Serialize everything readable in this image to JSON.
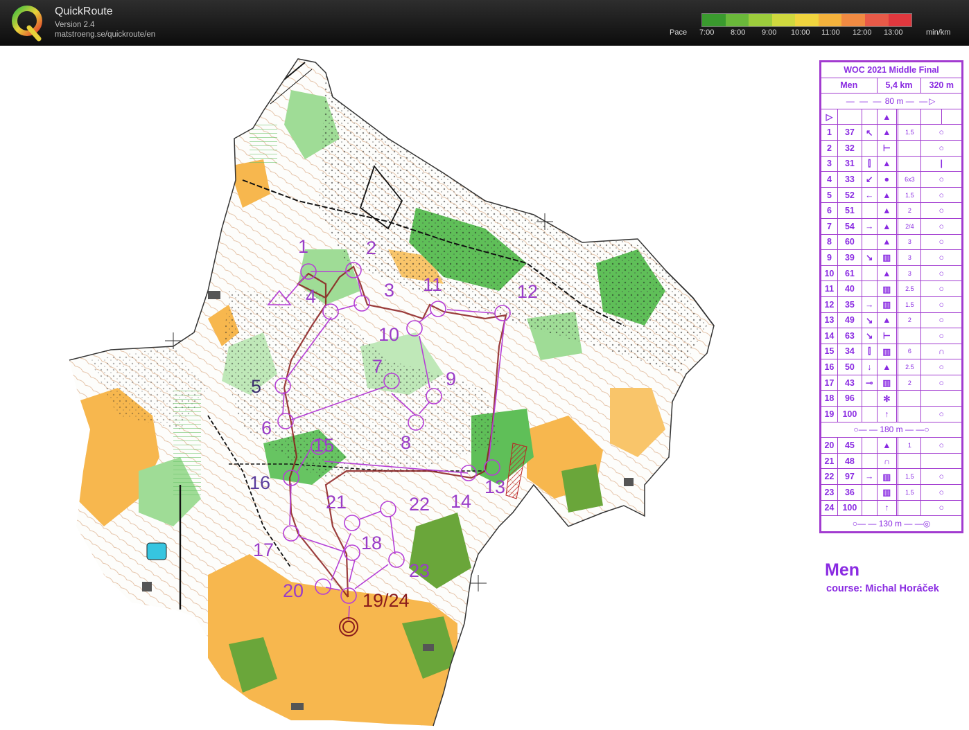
{
  "app": {
    "title": "QuickRoute",
    "version": "Version 2.4",
    "url": "matstroeng.se/quickroute/en",
    "logo_letter": "Q"
  },
  "pace_legend": {
    "label": "Pace",
    "ticks": [
      "7:00",
      "8:00",
      "9:00",
      "10:00",
      "11:00",
      "12:00",
      "13:00"
    ],
    "unit": "min/km",
    "gradient_colors": [
      "#3a9a2e",
      "#6ab83a",
      "#9ccc3c",
      "#cfd83e",
      "#f0d43e",
      "#f4b23c",
      "#f08a42",
      "#e85a48",
      "#e0383e"
    ]
  },
  "map": {
    "control_numbers": [
      "1",
      "2",
      "3",
      "4",
      "5",
      "6",
      "7",
      "8",
      "9",
      "10",
      "11",
      "12",
      "13",
      "14",
      "15",
      "16",
      "17",
      "18",
      "19/24",
      "20",
      "21",
      "22",
      "23"
    ],
    "colors": {
      "course": "#b53ed6",
      "route": "#8a1c1c",
      "open": "#f7b74e",
      "green": "#4fb84a",
      "contour": "#b05a1e"
    }
  },
  "control_descriptions": {
    "event": "WOC 2021 Middle Final",
    "class": "Men",
    "length": "5,4 km",
    "climb": "320 m",
    "start_marker": "80 m",
    "taped_route": "180 m",
    "finish_marker": "130 m",
    "rows": [
      {
        "n": "1",
        "code": "37",
        "dim": "1.5"
      },
      {
        "n": "2",
        "code": "32",
        "dim": ""
      },
      {
        "n": "3",
        "code": "31",
        "dim": ""
      },
      {
        "n": "4",
        "code": "33",
        "dim": "6x3"
      },
      {
        "n": "5",
        "code": "52",
        "dim": "1.5"
      },
      {
        "n": "6",
        "code": "51",
        "dim": "2"
      },
      {
        "n": "7",
        "code": "54",
        "dim": "2/4"
      },
      {
        "n": "8",
        "code": "60",
        "dim": "3"
      },
      {
        "n": "9",
        "code": "39",
        "dim": "3"
      },
      {
        "n": "10",
        "code": "61",
        "dim": "3"
      },
      {
        "n": "11",
        "code": "40",
        "dim": "2.5"
      },
      {
        "n": "12",
        "code": "35",
        "dim": "1.5"
      },
      {
        "n": "13",
        "code": "49",
        "dim": "2"
      },
      {
        "n": "14",
        "code": "63",
        "dim": ""
      },
      {
        "n": "15",
        "code": "34",
        "dim": "6"
      },
      {
        "n": "16",
        "code": "50",
        "dim": "2.5"
      },
      {
        "n": "17",
        "code": "43",
        "dim": "2"
      },
      {
        "n": "18",
        "code": "96",
        "dim": ""
      },
      {
        "n": "19",
        "code": "100",
        "dim": ""
      },
      {
        "n": "20",
        "code": "45",
        "dim": "1"
      },
      {
        "n": "21",
        "code": "48",
        "dim": ""
      },
      {
        "n": "22",
        "code": "97",
        "dim": "1.5"
      },
      {
        "n": "23",
        "code": "36",
        "dim": "1.5"
      },
      {
        "n": "24",
        "code": "100",
        "dim": ""
      }
    ]
  },
  "footer": {
    "class_name": "Men",
    "course_setter": "course: Michal Horáček"
  }
}
